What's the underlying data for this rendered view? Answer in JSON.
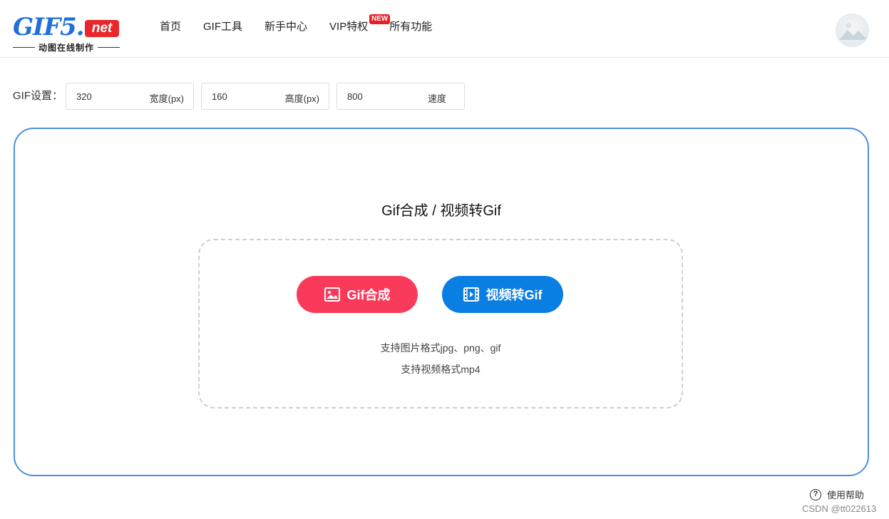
{
  "header": {
    "logo": {
      "main": "GIF5.",
      "net": "net",
      "subtitle": "动图在线制作"
    },
    "nav": [
      {
        "label": "首页"
      },
      {
        "label": "GIF工具"
      },
      {
        "label": "新手中心"
      },
      {
        "label": "VIP特权",
        "badge": "NEW"
      },
      {
        "label": "所有功能"
      }
    ]
  },
  "settings": {
    "label": "GIF设置：",
    "width": {
      "value": "320",
      "unit": "宽度(px)"
    },
    "height": {
      "value": "160",
      "unit": "高度(px)"
    },
    "speed": {
      "value": "800",
      "unit": "速度"
    }
  },
  "main": {
    "title": "Gif合成 / 视频转Gif",
    "gif_button": "Gif合成",
    "video_button": "视频转Gif",
    "hint_images": "支持图片格式jpg、png、gif",
    "hint_video": "支持视频格式mp4"
  },
  "help": {
    "label": "使用帮助"
  },
  "watermark": "CSDN @tt022613",
  "colors": {
    "brand_blue": "#1e6fd9",
    "gif_button": "#fa3a5a",
    "video_button": "#0a7fe3",
    "box_border": "#4a90e2"
  }
}
